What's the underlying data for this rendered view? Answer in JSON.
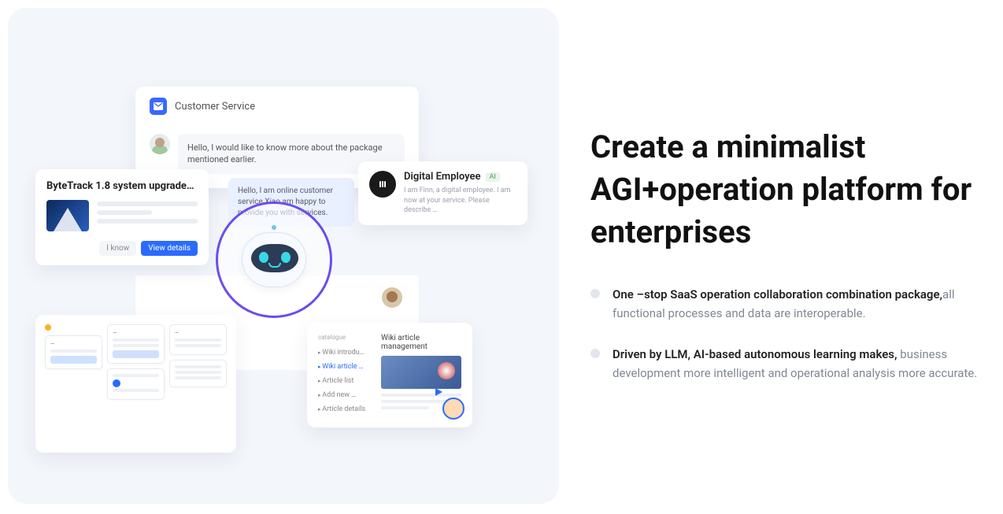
{
  "heading": "Create a minimalist AGI+operation platform for enterprises",
  "bullets": [
    {
      "bold": "One –stop SaaS operation collaboration combination package,",
      "rest": "all functional processes and data are interoperable."
    },
    {
      "bold": "Driven by LLM, AI-based autonomous learning makes,",
      "rest": " business development more intelligent and operational analysis more accurate."
    }
  ],
  "customer_service": {
    "title": "Customer Service",
    "message": "Hello, I would like to know more about the package mentioned earlier."
  },
  "welcome_message": "Hello, I am online customer service Xiao am happy to provide you with services.",
  "digital_employee": {
    "title": "Digital Employee",
    "badge": "AI",
    "desc": "I am Finn, a digital employee. I am now at your service. Please describe …"
  },
  "bytetrack": {
    "title": "ByteTrack 1.8 system upgrade…",
    "know_label": "I know",
    "view_label": "View details"
  },
  "wiki": {
    "catalogue_label": "catalogue",
    "items": [
      "Wiki introdu…",
      "Wiki article …",
      "Article list",
      "Add new …",
      "Article details"
    ],
    "title": "Wiki article management"
  }
}
